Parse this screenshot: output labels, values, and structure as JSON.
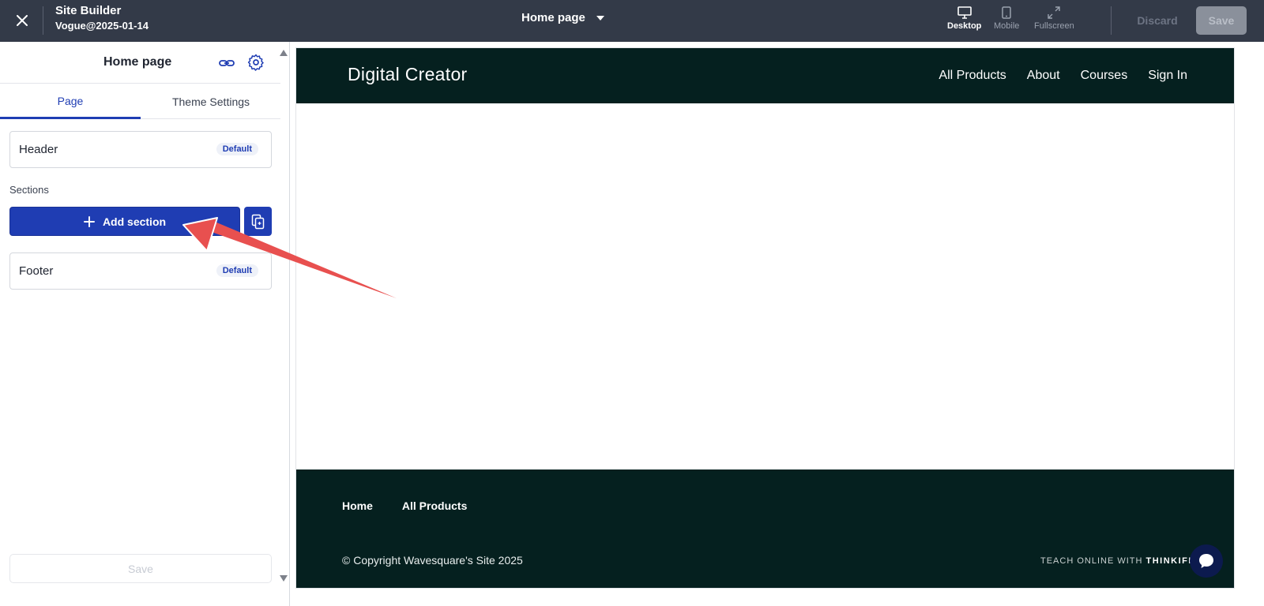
{
  "topbar": {
    "app_title": "Site Builder",
    "app_subtitle": "Vogue@2025-01-14",
    "page_selector": "Home page",
    "devices": [
      {
        "label": "Desktop",
        "icon": "desktop-icon",
        "active": true
      },
      {
        "label": "Mobile",
        "icon": "mobile-icon",
        "active": false
      },
      {
        "label": "Fullscreen",
        "icon": "fullscreen-icon",
        "active": false
      }
    ],
    "discard_label": "Discard",
    "save_label": "Save"
  },
  "sidebar": {
    "title": "Home page",
    "tabs": [
      {
        "label": "Page",
        "active": true
      },
      {
        "label": "Theme Settings",
        "active": false
      }
    ],
    "header_card": {
      "label": "Header",
      "badge": "Default"
    },
    "sections_label": "Sections",
    "add_section_label": "Add section",
    "footer_card": {
      "label": "Footer",
      "badge": "Default"
    },
    "save_label": "Save"
  },
  "preview": {
    "logo": "Digital Creator",
    "nav": [
      "All Products",
      "About",
      "Courses",
      "Sign In"
    ],
    "footer_links": [
      "Home",
      "All Products"
    ],
    "copyright": "© Copyright Wavesquare's Site 2025",
    "teach_prefix": "TEACH ONLINE WITH ",
    "teach_brand": "THINKIFIC"
  },
  "colors": {
    "topbar_bg": "#333a48",
    "accent": "#1f3db3",
    "site_dark": "#05201f",
    "annotation_arrow": "#e8504f"
  }
}
